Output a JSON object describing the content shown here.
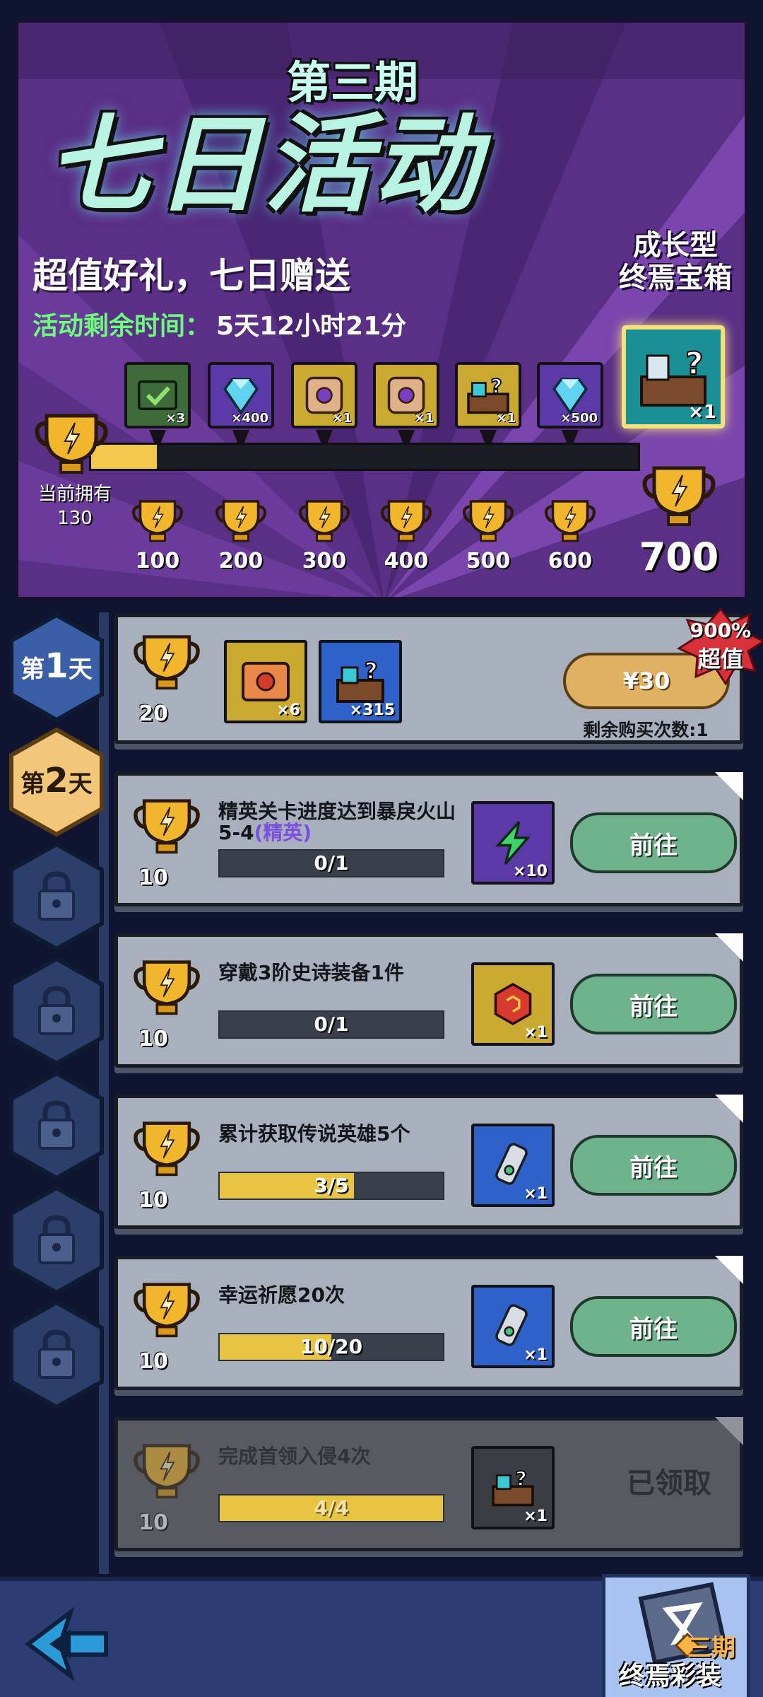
{
  "banner": {
    "period": "第三期",
    "title": "七日活动",
    "subtitle": "超值好礼，七日赠送",
    "timer_label": "活动剩余时间：",
    "timer_value": "5天12小时21分",
    "chest_title_line1": "成长型",
    "chest_title_line2": "终焉宝箱",
    "current_label": "当前拥有",
    "current_points": "130",
    "progress": {
      "current": 130,
      "max": 700
    },
    "milestone_rewards": [
      {
        "icon": "ticket-icon",
        "qty": "×3"
      },
      {
        "icon": "diamond-icon",
        "qty": "×400"
      },
      {
        "icon": "medal-icon",
        "qty": "×1"
      },
      {
        "icon": "medal-icon",
        "qty": "×1"
      },
      {
        "icon": "mystery-chest-icon",
        "qty": "×1"
      },
      {
        "icon": "diamond-icon",
        "qty": "×500"
      }
    ],
    "milestones": [
      "100",
      "200",
      "300",
      "400",
      "500",
      "600"
    ],
    "final_reward_qty": "×1",
    "final_milestone": "700"
  },
  "tabs": [
    {
      "prefix": "第",
      "day": "1",
      "suffix": "天",
      "state": "unlocked"
    },
    {
      "prefix": "第",
      "day": "2",
      "suffix": "天",
      "state": "active"
    },
    {
      "state": "locked"
    },
    {
      "state": "locked"
    },
    {
      "state": "locked"
    },
    {
      "state": "locked"
    },
    {
      "state": "locked"
    }
  ],
  "purchase": {
    "points": "20",
    "rewards": [
      {
        "icon": "scroll-icon",
        "qty": "×6"
      },
      {
        "icon": "mystery-chest-icon",
        "qty": "×315"
      }
    ],
    "price": "¥30",
    "remaining": "剩余购买次数:1",
    "badge_pct": "900%",
    "badge_word": "超值"
  },
  "tasks": [
    {
      "points": "10",
      "title": "精英关卡进度达到暴戾火山5-4",
      "title_suffix": "(精英)",
      "progress_text": "0/1",
      "progress": 0,
      "reward_icon": "lightning-icon",
      "reward_qty": "×10",
      "reward_color": "#5b3aa8",
      "action": "前往"
    },
    {
      "points": "10",
      "title": "穿戴3阶史诗装备1件",
      "title_suffix": "",
      "progress_text": "0/1",
      "progress": 0,
      "reward_icon": "gem-icon",
      "reward_qty": "×1",
      "reward_color": "#c9a92f",
      "action": "前往"
    },
    {
      "points": "10",
      "title": "累计获取传说英雄5个",
      "title_suffix": "",
      "progress_text": "3/5",
      "progress": 0.6,
      "reward_icon": "hero-scroll-icon",
      "reward_qty": "×1",
      "reward_color": "#2e62c9",
      "action": "前往"
    },
    {
      "points": "10",
      "title": "幸运祈愿20次",
      "title_suffix": "",
      "progress_text": "10/20",
      "progress": 0.5,
      "reward_icon": "hero-scroll-icon",
      "reward_qty": "×1",
      "reward_color": "#2e62c9",
      "action": "前往"
    },
    {
      "points": "10",
      "title": "完成首领入侵4次",
      "title_suffix": "",
      "progress_text": "4/4",
      "progress": 1,
      "reward_icon": "mystery-chest-icon",
      "reward_qty": "×1",
      "reward_color": "#3a3d44",
      "action": "已领取"
    }
  ],
  "bottom": {
    "final_chest_period": "三期",
    "final_chest_label": "终焉彩装"
  }
}
